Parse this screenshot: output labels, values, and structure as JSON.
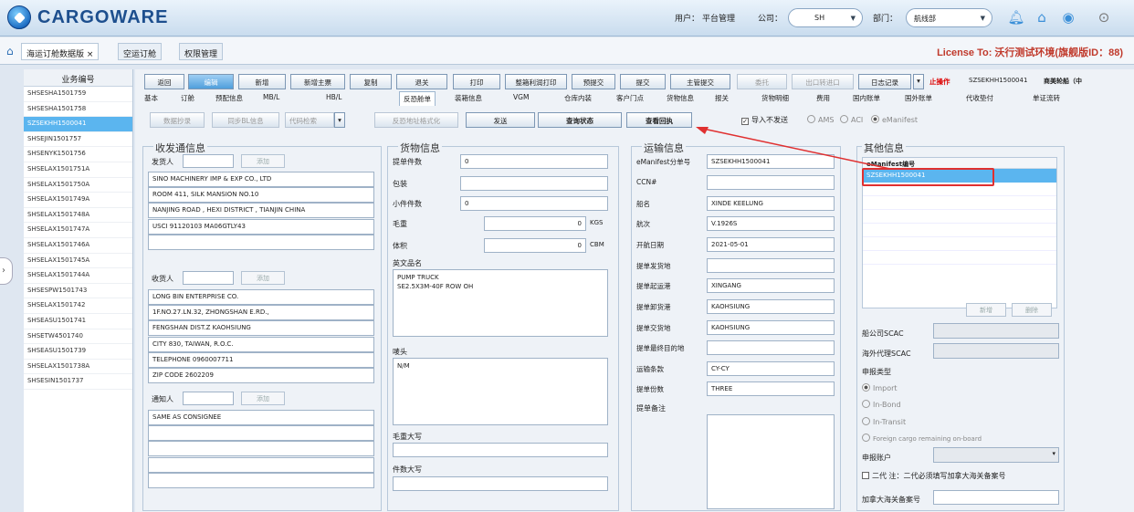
{
  "app": {
    "logo": "CARGOWARE"
  },
  "topbar": {
    "user_label": "用户：",
    "user": "平台管理",
    "company_label": "公司：",
    "company": "SH",
    "dept_label": "部门：",
    "dept": "航线部"
  },
  "tabs": [
    {
      "label": "海运订舱数据版 ×"
    },
    {
      "label": "空运订舱"
    },
    {
      "label": "权限管理"
    }
  ],
  "license": "License To: 沃行测试环境(旗舰版ID：88)",
  "leftlist": {
    "header": "业务编号",
    "items": [
      "SHSESHA1501759",
      "SHSESHA1501758",
      "SZSEKHH1500041",
      "SHSEJIN1501757",
      "SHSENYK1501756",
      "SHSELAX1501751A",
      "SHSELAX1501750A",
      "SHSELAX1501749A",
      "SHSELAX1501748A",
      "SHSELAX1501747A",
      "SHSELAX1501746A",
      "SHSELAX1501745A",
      "SHSELAX1501744A",
      "SHSESPW1501743",
      "SHSELAX1501742",
      "SHSEASU1501741",
      "SHSETW4501740",
      "SHSEASU1501739",
      "SHSELAX1501738A",
      "SHSESIN1501737"
    ]
  },
  "toolbar": {
    "buttons": [
      "返回",
      "编辑",
      "新增",
      "新增主票",
      "复制",
      "退关",
      "打印",
      "整箱利润打印",
      "预提交",
      "提交",
      "主管提交",
      "委托",
      "出口转进口",
      "日志记录"
    ],
    "stop_label": "止操作",
    "ref": "SZSEKHH1500041",
    "carrier": "商美轮船（中"
  },
  "subtabs": [
    "基本",
    "订舱",
    "预配信息",
    "MB/L",
    "HB/L",
    "反恐舱单",
    "装箱信息",
    "VGM",
    "仓库内装",
    "客户门点",
    "货物信息",
    "报关",
    "货物明细",
    "费用",
    "国内账单",
    "国外账单",
    "代收垫付",
    "单证流转"
  ],
  "actions": {
    "data_extract": "数据抄录",
    "sync_bl": "同步BL信息",
    "code_lookup": "代码检索",
    "anti_terror_format": "反恐地址格式化",
    "send": "发送",
    "query_status": "查询状态",
    "view_receipt": "查看回执",
    "import_no_send": "导入不发送",
    "modes": [
      "AMS",
      "ACI",
      "eManifest"
    ]
  },
  "shipper_group": {
    "title": "收发通信息",
    "shipper_label": "发货人",
    "add": "添加",
    "shipper_lines": [
      "SINO MACHINERY IMP & EXP CO., LTD",
      "ROOM 411, SILK MANSION NO.10",
      "NANJING ROAD , HEXI DISTRICT , TIANJIN CHINA",
      "USCI 91120103 MA06GTLY43",
      ""
    ],
    "consignee_label": "收货人",
    "consignee_lines": [
      "LONG BIN ENTERPRISE CO.",
      "1F.NO.27.LN.32, ZHONGSHAN E.RD.,",
      "FENGSHAN DIST.Z KAOHSIUNG",
      "CITY 830, TAIWAN, R.O.C.",
      "TELEPHONE 0960007711",
      "ZIP CODE 2602209"
    ],
    "notify_label": "通知人",
    "notify_lines": [
      "SAME AS CONSIGNEE",
      "",
      "",
      "",
      ""
    ]
  },
  "cargo_group": {
    "title": "货物信息",
    "pieces_label": "提单件数",
    "pieces": "0",
    "package_label": "包装",
    "small_pieces_label": "小件件数",
    "small_pieces": "0",
    "weight_label": "毛重",
    "weight": "0",
    "weight_unit": "KGS",
    "volume_label": "体积",
    "volume": "0",
    "volume_unit": "CBM",
    "desc_label": "英文品名",
    "desc": "PUMP TRUCK\nSE2.5X3M-40F ROW OH",
    "marks_label": "唛头",
    "marks": "N/M",
    "weight_cap_label": "毛重大写",
    "pieces_cap_label": "件数大写"
  },
  "transport_group": {
    "title": "运输信息",
    "fields": [
      {
        "label": "eManifest分单号",
        "value": "SZSEKHH1500041"
      },
      {
        "label": "CCN#",
        "value": ""
      },
      {
        "label": "船名",
        "value": "XINDE KEELUNG"
      },
      {
        "label": "航次",
        "value": "V.1926S"
      },
      {
        "label": "开航日期",
        "value": "2021-05-01"
      },
      {
        "label": "提单发货地",
        "value": ""
      },
      {
        "label": "提单起运港",
        "value": "XINGANG"
      },
      {
        "label": "提单卸货港",
        "value": "KAOHSIUNG"
      },
      {
        "label": "提单交货地",
        "value": "KAOHSIUNG"
      },
      {
        "label": "提单最终目的地",
        "value": ""
      },
      {
        "label": "运输条款",
        "value": "CY-CY"
      },
      {
        "label": "提单份数",
        "value": "THREE"
      }
    ],
    "remark_label": "提单备注"
  },
  "other_group": {
    "title": "其他信息",
    "col_header": "eManifest编号",
    "rows": [
      "SZSEKHH1500041"
    ],
    "add": "新增",
    "delete": "删除",
    "scac_label": "船公司SCAC",
    "agent_scac_label": "海外代理SCAC",
    "decl_type_label": "申报类型",
    "decl_types": [
      "Import",
      "In-Bond",
      "In-Transit",
      "Foreign cargo remaining on-board"
    ],
    "decl_account_label": "申报账户",
    "second_agent_label": "二代 注：二代必须填写加拿大海关备案号",
    "canada_no_label": "加拿大海关备案号"
  }
}
